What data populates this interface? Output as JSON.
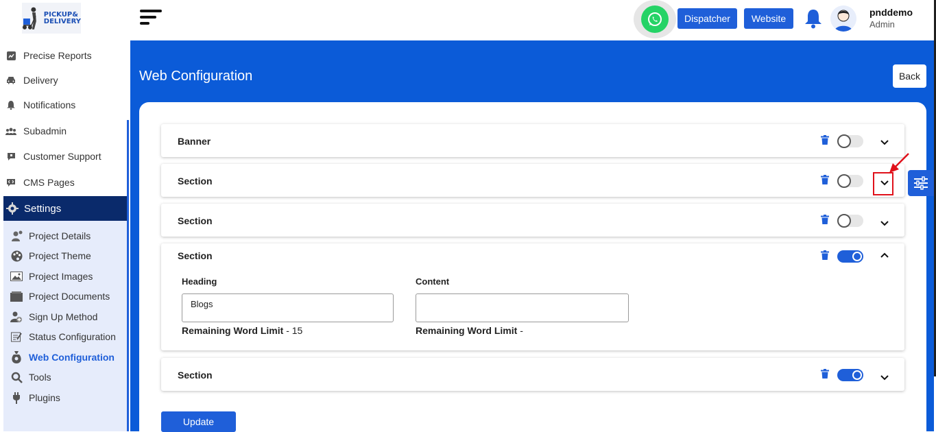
{
  "brand": {
    "logo_line1": "PICKUP&",
    "logo_line2": "DELIVERY"
  },
  "sidebar": {
    "items": [
      {
        "label": "Precise Reports",
        "icon": "chart-icon"
      },
      {
        "label": "Delivery",
        "icon": "car-icon"
      },
      {
        "label": "Notifications",
        "icon": "bell-icon"
      },
      {
        "label": "Subadmin",
        "icon": "users-icon"
      },
      {
        "label": "Customer Support",
        "icon": "chat-icon"
      },
      {
        "label": "CMS Pages",
        "icon": "code-icon"
      }
    ],
    "settings": {
      "label": "Settings",
      "icon": "gear-icon"
    },
    "submenu": [
      {
        "label": "Project Details",
        "icon": "user-gear-icon"
      },
      {
        "label": "Project Theme",
        "icon": "palette-icon"
      },
      {
        "label": "Project Images",
        "icon": "image-icon"
      },
      {
        "label": "Project Documents",
        "icon": "documents-icon"
      },
      {
        "label": "Sign Up Method",
        "icon": "user-plus-icon"
      },
      {
        "label": "Status Configuration",
        "icon": "status-icon"
      },
      {
        "label": "Web Configuration",
        "icon": "web-config-icon",
        "active": true
      },
      {
        "label": "Tools",
        "icon": "tools-icon"
      },
      {
        "label": "Plugins",
        "icon": "plug-icon"
      }
    ]
  },
  "topbar": {
    "dispatcher_label": "Dispatcher",
    "website_label": "Website",
    "user_name": "pnddemo",
    "user_role": "Admin"
  },
  "page": {
    "title": "Web Configuration",
    "back_label": "Back",
    "update_label": "Update"
  },
  "accordions": [
    {
      "title": "Banner",
      "enabled": false,
      "expanded": false
    },
    {
      "title": "Section",
      "enabled": false,
      "expanded": false
    },
    {
      "title": "Section",
      "enabled": false,
      "expanded": false
    },
    {
      "title": "Section",
      "enabled": true,
      "expanded": true,
      "fields": {
        "heading_label": "Heading",
        "heading_value": "Blogs",
        "content_label": "Content",
        "content_value": "",
        "limit_label": "Remaining Word Limit",
        "heading_limit": " - 15",
        "content_limit": " -"
      }
    },
    {
      "title": "Section",
      "enabled": true,
      "expanded": false
    }
  ],
  "colors": {
    "primary": "#1f5fd9",
    "header_blue": "#0b5bd8",
    "settings_bg": "#0a2a6b",
    "submenu_bg": "#e6ecfb",
    "annotation_red": "#e0101a"
  }
}
